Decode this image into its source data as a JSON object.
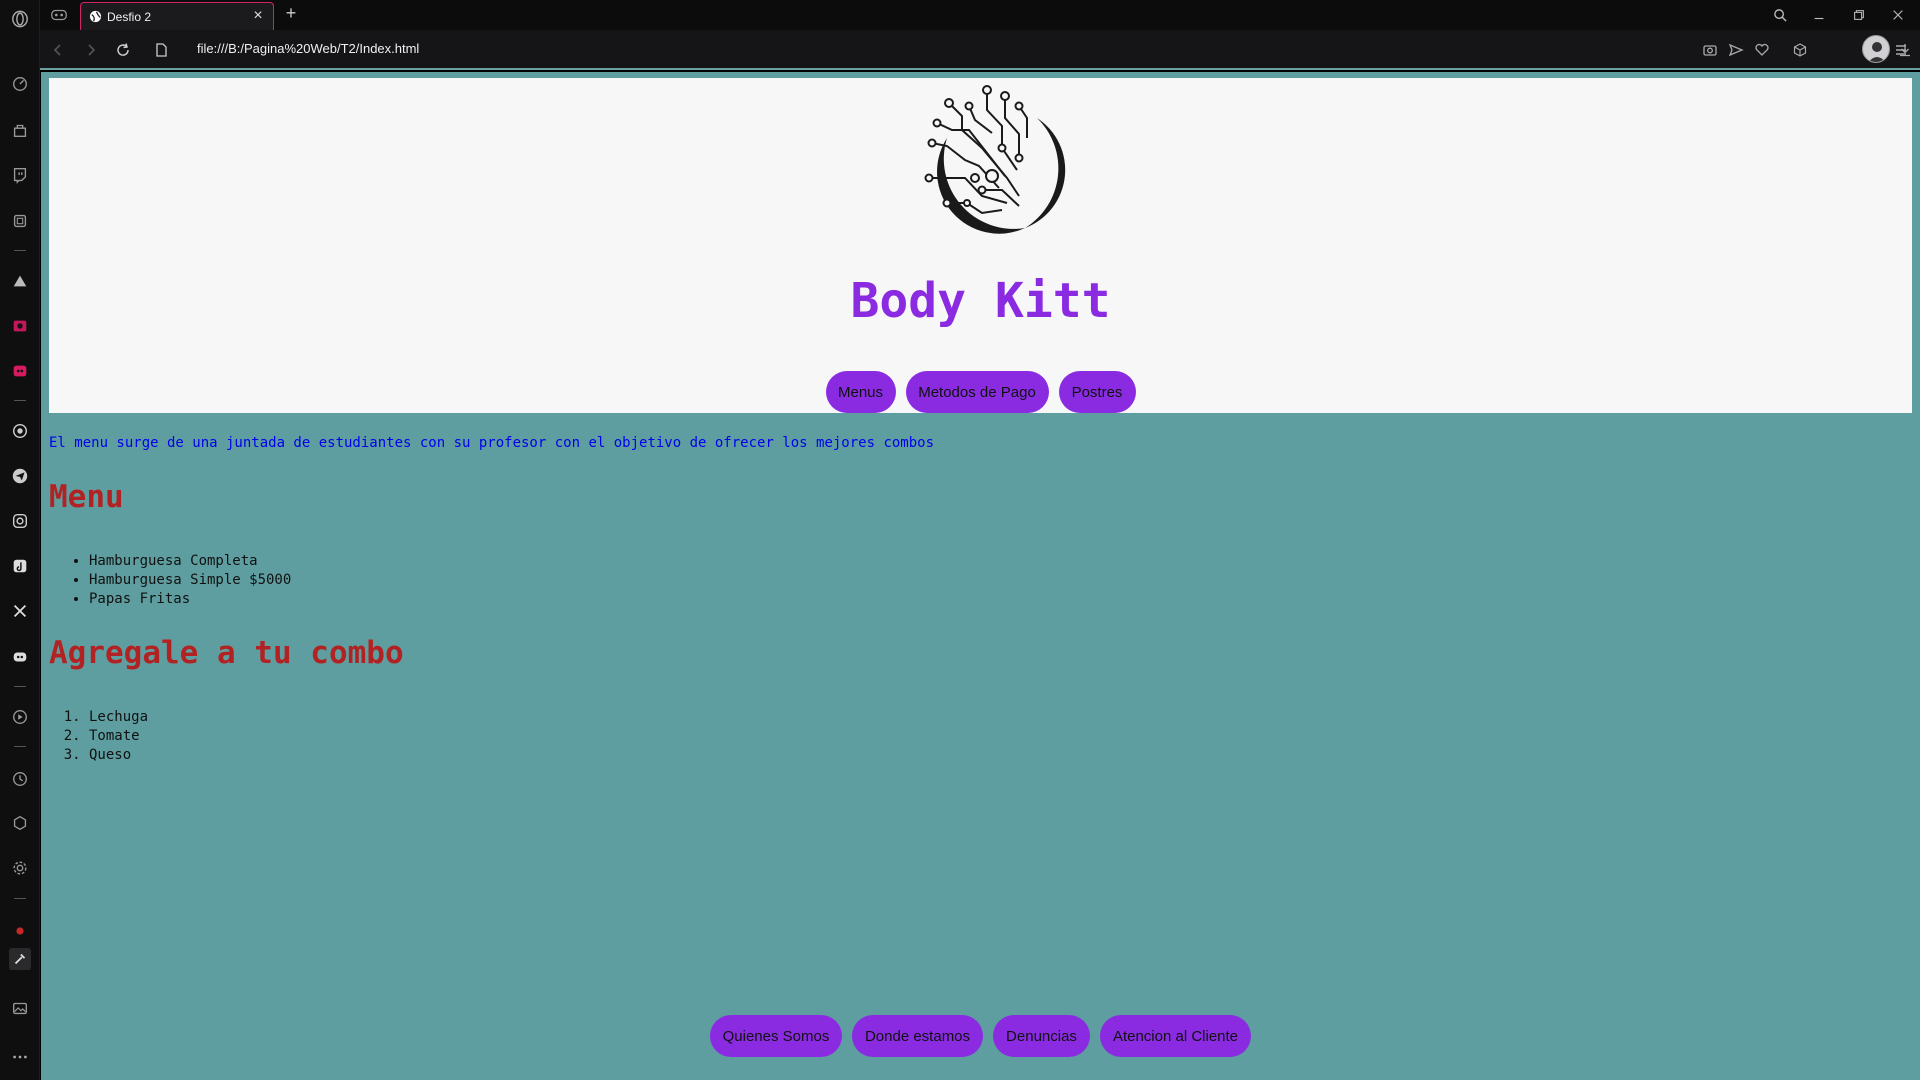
{
  "browser": {
    "tab_title": "Desfio 2",
    "tab_close": "×",
    "new_tab": "+",
    "url": "file:///B:/Pagina%20Web/T2/Index.html"
  },
  "site": {
    "title": "Body Kitt",
    "nav_buttons": [
      "Menus",
      "Metodos de Pago",
      "Postres"
    ],
    "intro": "El menu surge de una juntada de estudiantes con su profesor con el objetivo de ofrecer los mejores combos",
    "menu_heading": "Menu",
    "menu_items": [
      "Hamburguesa Completa",
      "Hamburguesa Simple $5000",
      "Papas Fritas"
    ],
    "combo_heading": "Agregale a tu combo",
    "combo_items": [
      "Lechuga",
      "Tomate",
      "Queso"
    ],
    "footer_buttons": [
      "Quienes Somos",
      "Donde estamos",
      "Denuncias",
      "Atencion al Cliente"
    ]
  },
  "colors": {
    "page_bg": "#5f9ea0",
    "header_bg": "#f7f7f7",
    "accent_purple": "#8a2be2",
    "heading_red": "#b22222",
    "intro_blue": "#0000ee",
    "tab_border": "#d0246a"
  }
}
